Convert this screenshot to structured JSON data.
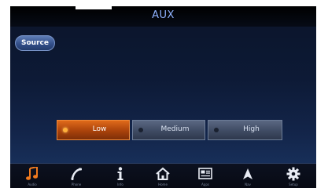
{
  "header": {
    "title": "AUX"
  },
  "source_button": {
    "label": "Source"
  },
  "treble_levels": {
    "options": [
      {
        "label": "Low",
        "active": true
      },
      {
        "label": "Medium",
        "active": false
      },
      {
        "label": "High",
        "active": false
      }
    ]
  },
  "bottom_nav": {
    "items": [
      {
        "icon": "music-note-icon",
        "label": "Audio",
        "active": true
      },
      {
        "icon": "phone-icon",
        "label": "Phone",
        "active": false
      },
      {
        "icon": "info-icon",
        "label": "Info",
        "active": false
      },
      {
        "icon": "home-icon",
        "label": "Home",
        "active": false
      },
      {
        "icon": "apps-icon",
        "label": "Apps",
        "active": false
      },
      {
        "icon": "navigation-arrow-icon",
        "label": "Nav",
        "active": false
      },
      {
        "icon": "gear-icon",
        "label": "Setup",
        "active": false
      }
    ]
  },
  "colors": {
    "accent_active": "#e06a1a",
    "title_color": "#8fb2ff",
    "screen_bg": "#0d1a36"
  }
}
